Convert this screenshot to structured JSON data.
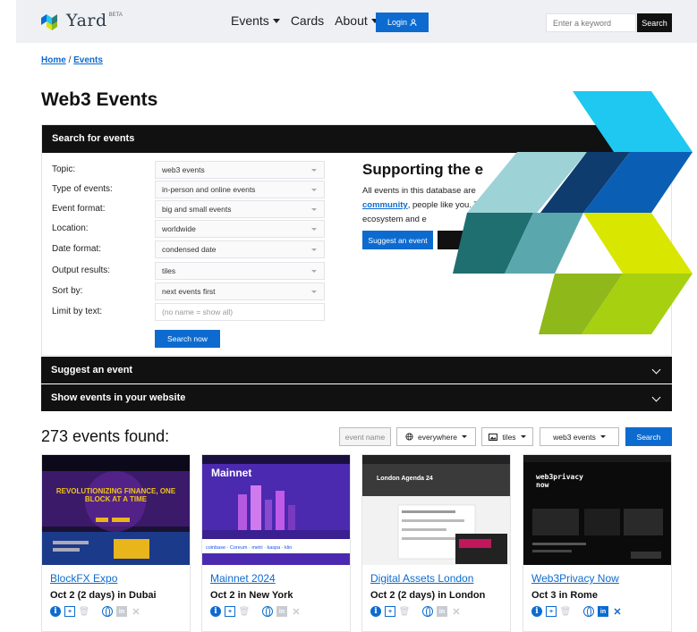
{
  "header": {
    "logo_text": "Yard",
    "logo_badge": "BETA",
    "nav": [
      {
        "label": "Events",
        "dropdown": true
      },
      {
        "label": "Cards",
        "dropdown": false
      },
      {
        "label": "About",
        "dropdown": true
      }
    ],
    "login_label": "Login",
    "search_placeholder": "Enter a keyword",
    "search_button": "Search"
  },
  "breadcrumb": {
    "home": "Home",
    "separator": "/",
    "current": "Events"
  },
  "page_title": "Web3 Events",
  "search_panel": {
    "header": "Search for events",
    "fields": [
      {
        "label": "Topic:",
        "value": "web3 events"
      },
      {
        "label": "Type of events:",
        "value": "in-person and online events"
      },
      {
        "label": "Event format:",
        "value": "big and small events"
      },
      {
        "label": "Location:",
        "value": "worldwide"
      },
      {
        "label": "Date format:",
        "value": "condensed date"
      },
      {
        "label": "Output results:",
        "value": "tiles"
      },
      {
        "label": "Sort by:",
        "value": "next events first"
      },
      {
        "label": "Limit by text:",
        "placeholder": "(no name = show all)"
      }
    ],
    "submit": "Search now"
  },
  "support": {
    "title": "Supporting the e",
    "text_1": "All events in this database are",
    "link": "community",
    "text_2": ", people like you. Tog",
    "text_3": "ecosystem and e",
    "button": "Suggest an event"
  },
  "accordions": [
    "Suggest an event",
    "Show events in your website"
  ],
  "results": {
    "title": "273 events found:",
    "name_placeholder": "event name",
    "location": "everywhere",
    "view": "tiles",
    "topic": "web3 events",
    "search": "Search"
  },
  "events": [
    {
      "title": "BlockFX Expo",
      "date": "Oct 2 (2 days) in Dubai",
      "thumb_text": "REVOLUTIONIZING FINANCE, ONE BLOCK AT A TIME",
      "x_active": false
    },
    {
      "title": "Mainnet 2024",
      "date": "Oct 2 in New York",
      "thumb_text": "Mainnet",
      "x_active": false
    },
    {
      "title": "Digital Assets London",
      "date": "Oct 2 (2 days) in London",
      "thumb_text": "London Agenda 24",
      "x_active": false
    },
    {
      "title": "Web3Privacy Now",
      "date": "Oct 3 in Rome",
      "thumb_text": "web3privacy now",
      "x_active": true
    }
  ]
}
